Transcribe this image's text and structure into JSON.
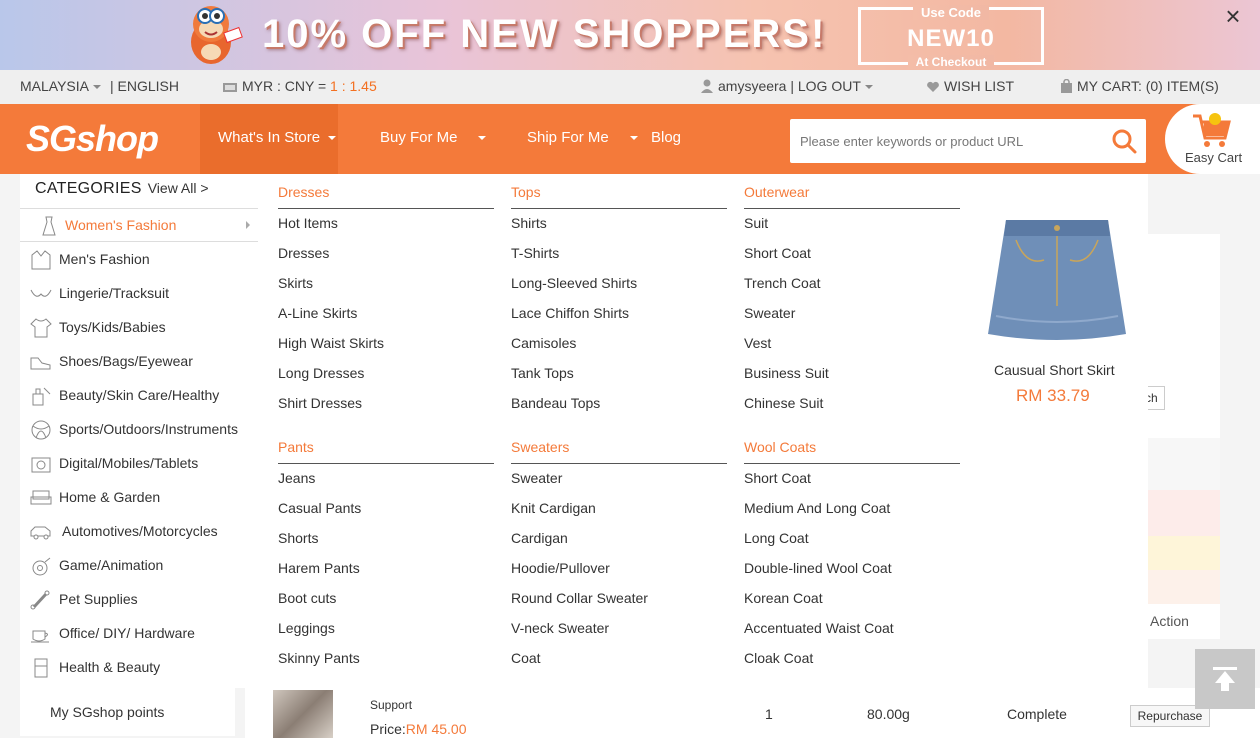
{
  "banner": {
    "headline": "10% OFF NEW SHOPPERS!",
    "code_top": "Use Code",
    "code": "NEW10",
    "code_bottom": "At Checkout",
    "close": "×"
  },
  "utilbar": {
    "region": "MALAYSIA",
    "language": "| ENGLISH",
    "currency_label": "MYR : CNY = ",
    "rate": "1 : 1.45",
    "user": "amysyeera | LOG OUT",
    "wishlist": "WISH LIST",
    "cart": "MY CART: (0) ITEM(S)"
  },
  "nav": {
    "logo": "SGshop",
    "items": [
      {
        "label": "What's In Store"
      },
      {
        "label": "Buy For Me"
      },
      {
        "label": "Ship For Me"
      },
      {
        "label": "Blog"
      }
    ],
    "search_placeholder": "Please enter keywords or product URL",
    "easy_cart": "Easy Cart"
  },
  "categories": {
    "title": "CATEGORIES",
    "view_all": "View All >",
    "items": [
      {
        "label": "Women's Fashion",
        "icon": "dress-icon"
      },
      {
        "label": "Men's Fashion",
        "icon": "jacket-icon"
      },
      {
        "label": "Lingerie/Tracksuit",
        "icon": "bra-icon"
      },
      {
        "label": "Toys/Kids/Babies",
        "icon": "baby-shirt-icon"
      },
      {
        "label": "Shoes/Bags/Eyewear",
        "icon": "shoe-icon"
      },
      {
        "label": "Beauty/Skin Care/Healthy",
        "icon": "perfume-icon"
      },
      {
        "label": "Sports/Outdoors/Instruments",
        "icon": "ball-icon"
      },
      {
        "label": "Digital/Mobiles/Tablets",
        "icon": "camera-icon"
      },
      {
        "label": "Home & Garden",
        "icon": "sofa-icon"
      },
      {
        "label": "Automotives/Motorcycles",
        "icon": "car-icon"
      },
      {
        "label": "Game/Animation",
        "icon": "gamepad-icon"
      },
      {
        "label": "Pet Supplies",
        "icon": "bone-icon"
      },
      {
        "label": "Office/ DIY/ Hardware",
        "icon": "mug-icon"
      },
      {
        "label": "Health & Beauty",
        "icon": "fridge-icon"
      }
    ]
  },
  "mega": {
    "columns": [
      {
        "head": "Dresses",
        "items": [
          "Hot Items",
          "Dresses",
          "Skirts",
          "A-Line Skirts",
          "High Waist Skirts",
          "Long Dresses",
          "Shirt Dresses"
        ]
      },
      {
        "head": "Tops",
        "items": [
          "Shirts",
          "T-Shirts",
          "Long-Sleeved Shirts",
          "Lace Chiffon Shirts",
          "Camisoles",
          "Tank Tops",
          "Bandeau Tops"
        ]
      },
      {
        "head": "Outerwear",
        "items": [
          "Suit",
          "Short Coat",
          "Trench Coat",
          "Sweater",
          "Vest",
          "Business Suit",
          "Chinese Suit"
        ]
      },
      {
        "head": "Pants",
        "items": [
          "Jeans",
          "Casual Pants",
          "Shorts",
          "Harem Pants",
          "Boot cuts",
          "Leggings",
          "Skinny Pants"
        ]
      },
      {
        "head": "Sweaters",
        "items": [
          "Sweater",
          "Knit Cardigan",
          "Cardigan",
          "Hoodie/Pullover",
          "Round Collar Sweater",
          "V-neck Sweater",
          "Coat"
        ]
      },
      {
        "head": "Wool Coats",
        "items": [
          "Short Coat",
          "Medium And Long Coat",
          "Long Coat",
          "Double-lined Wool Coat",
          "Korean Coat",
          "Accentuated Waist Coat",
          "Cloak Coat"
        ]
      }
    ],
    "featured": {
      "name": "Causual Short Skirt",
      "price": "RM 33.79"
    }
  },
  "background": {
    "action_header": "Action",
    "partial_button": "ch",
    "points": "My SGshop points",
    "order": {
      "support": "Support",
      "price_label": "Price:",
      "price": "RM 45.00",
      "qty": "1",
      "weight": "80.00g",
      "status": "Complete",
      "repurchase": "Repurchase"
    }
  },
  "colors": {
    "accent": "#f47a3a",
    "nav_bg": "#f47a3a"
  }
}
